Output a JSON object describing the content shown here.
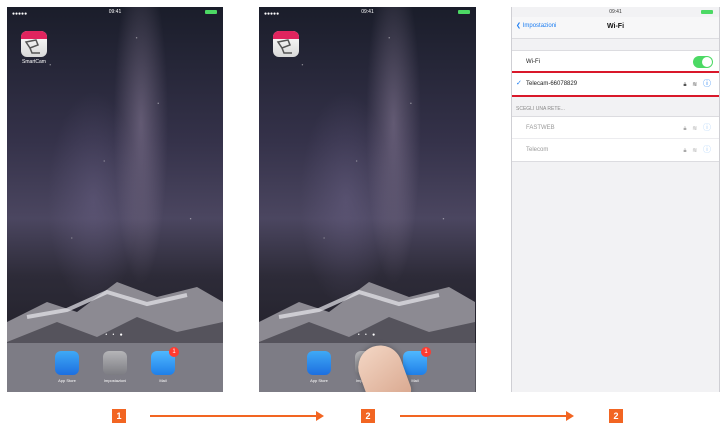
{
  "home_screen": {
    "status_time": "09:41",
    "app": {
      "name": "SmartCam",
      "icon": "smartcam-icon",
      "band_color": "#e0245e"
    },
    "page_dots": "• • ●",
    "dock": [
      {
        "label": "App Store",
        "icon": "app-store-icon"
      },
      {
        "label": "Impostazioni",
        "icon": "settings-icon"
      },
      {
        "label": "Mail",
        "icon": "mail-icon",
        "badge": "1"
      }
    ]
  },
  "wifi_screen": {
    "status_time": "09:41",
    "back_label": "Impostazioni",
    "title": "Wi-Fi",
    "wifi_label": "Wi-Fi",
    "connected_network": "Telecam-66078829",
    "section_header": "SCEGLI UNA RETE...",
    "networks": [
      {
        "name": "FASTWEB"
      },
      {
        "name": "Telecom"
      }
    ]
  },
  "steps": [
    "1",
    "2",
    "2"
  ],
  "colors": {
    "accent": "#f26522",
    "highlight": "#d9182a",
    "ios_blue": "#1a7cf2",
    "toggle_on": "#4cd964"
  }
}
